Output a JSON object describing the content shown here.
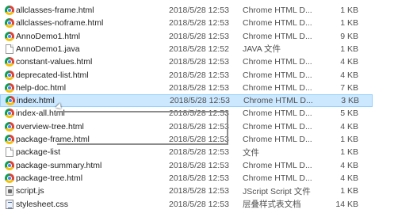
{
  "files": [
    {
      "name": "allclasses-frame.html",
      "date": "2018/5/28 12:53",
      "type": "Chrome HTML D...",
      "size": "1 KB",
      "icon": "chrome-icon",
      "selected": false
    },
    {
      "name": "allclasses-noframe.html",
      "date": "2018/5/28 12:53",
      "type": "Chrome HTML D...",
      "size": "1 KB",
      "icon": "chrome-icon",
      "selected": false
    },
    {
      "name": "AnnoDemo1.html",
      "date": "2018/5/28 12:53",
      "type": "Chrome HTML D...",
      "size": "9 KB",
      "icon": "chrome-icon",
      "selected": false
    },
    {
      "name": "AnnoDemo1.java",
      "date": "2018/5/28 12:52",
      "type": "JAVA 文件",
      "size": "1 KB",
      "icon": "document-icon",
      "selected": false
    },
    {
      "name": "constant-values.html",
      "date": "2018/5/28 12:53",
      "type": "Chrome HTML D...",
      "size": "4 KB",
      "icon": "chrome-icon",
      "selected": false
    },
    {
      "name": "deprecated-list.html",
      "date": "2018/5/28 12:53",
      "type": "Chrome HTML D...",
      "size": "4 KB",
      "icon": "chrome-icon",
      "selected": false
    },
    {
      "name": "help-doc.html",
      "date": "2018/5/28 12:53",
      "type": "Chrome HTML D...",
      "size": "7 KB",
      "icon": "chrome-icon",
      "selected": false
    },
    {
      "name": "index.html",
      "date": "2018/5/28 12:53",
      "type": "Chrome HTML D...",
      "size": "3 KB",
      "icon": "chrome-icon",
      "selected": true
    },
    {
      "name": "index-all.html",
      "date": "2018/5/28 12:53",
      "type": "Chrome HTML D...",
      "size": "5 KB",
      "icon": "chrome-icon",
      "selected": false
    },
    {
      "name": "overview-tree.html",
      "date": "2018/5/28 12:53",
      "type": "Chrome HTML D...",
      "size": "4 KB",
      "icon": "chrome-icon",
      "selected": false
    },
    {
      "name": "package-frame.html",
      "date": "2018/5/28 12:53",
      "type": "Chrome HTML D...",
      "size": "1 KB",
      "icon": "chrome-icon",
      "selected": false
    },
    {
      "name": "package-list",
      "date": "2018/5/28 12:53",
      "type": "文件",
      "size": "1 KB",
      "icon": "document-icon",
      "selected": false
    },
    {
      "name": "package-summary.html",
      "date": "2018/5/28 12:53",
      "type": "Chrome HTML D...",
      "size": "4 KB",
      "icon": "chrome-icon",
      "selected": false
    },
    {
      "name": "package-tree.html",
      "date": "2018/5/28 12:53",
      "type": "Chrome HTML D...",
      "size": "4 KB",
      "icon": "chrome-icon",
      "selected": false
    },
    {
      "name": "script.js",
      "date": "2018/5/28 12:53",
      "type": "JScript Script 文件",
      "size": "1 KB",
      "icon": "script-icon",
      "selected": false
    },
    {
      "name": "stylesheet.css",
      "date": "2018/5/28 12:53",
      "type": "层叠样式表文档",
      "size": "14 KB",
      "icon": "stylesheet-icon",
      "selected": false
    }
  ]
}
